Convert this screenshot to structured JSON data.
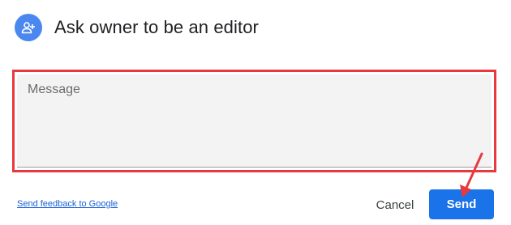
{
  "dialog": {
    "title": "Ask owner to be an editor",
    "avatar_icon": "person-add-icon",
    "accent_color": "#4a88f0"
  },
  "message": {
    "placeholder": "Message",
    "value": ""
  },
  "footer": {
    "feedback_link": "Send feedback to Google",
    "cancel_label": "Cancel",
    "send_label": "Send",
    "send_color": "#1a73e8"
  },
  "annotations": {
    "highlight_color": "#e8393f",
    "highlight_target": "message-field",
    "arrow_target": "send-button"
  }
}
